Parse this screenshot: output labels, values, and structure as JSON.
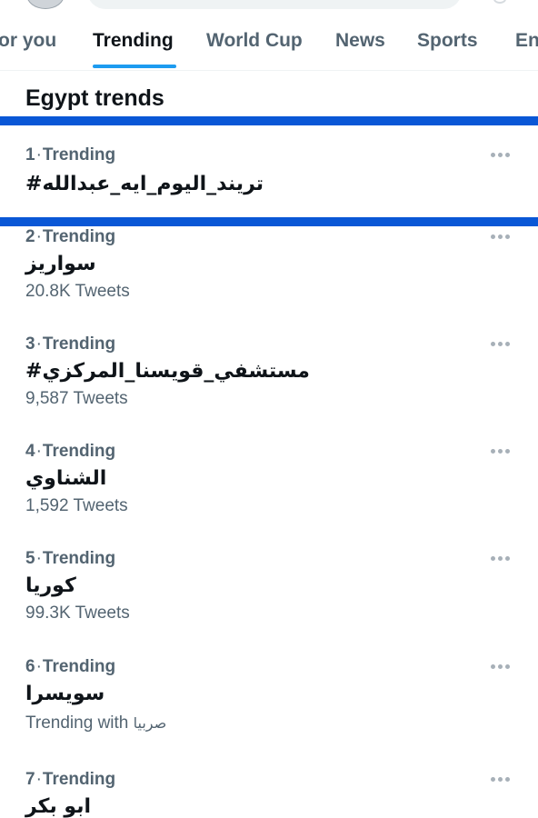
{
  "tabs": [
    {
      "label": "or you",
      "active": false
    },
    {
      "label": "Trending",
      "active": true
    },
    {
      "label": "World Cup",
      "active": false
    },
    {
      "label": "News",
      "active": false
    },
    {
      "label": "Sports",
      "active": false
    },
    {
      "label": "En",
      "active": false
    }
  ],
  "section": {
    "title": "Egypt trends"
  },
  "trend_label": "Trending",
  "colors": {
    "accent": "#1d9bf0",
    "highlight_border": "#0a57d6",
    "muted_text": "#536471"
  },
  "icons": {
    "more": "more-horizontal-icon"
  },
  "trends": [
    {
      "rank": "1",
      "context": "Trending",
      "name": "#تريند_اليوم_ايه_عبدالله",
      "count": ""
    },
    {
      "rank": "2",
      "context": "Trending",
      "name": "سواريز",
      "count": "20.8K Tweets"
    },
    {
      "rank": "3",
      "context": "Trending",
      "name": "#مستشفي_قويسنا_المركزي",
      "count": "9,587 Tweets"
    },
    {
      "rank": "4",
      "context": "Trending",
      "name": "الشناوي",
      "count": "1,592 Tweets"
    },
    {
      "rank": "5",
      "context": "Trending",
      "name": "كوريا",
      "count": "99.3K Tweets"
    },
    {
      "rank": "6",
      "context": "Trending",
      "name": "سويسرا",
      "count": "Trending with",
      "with": "صربيا"
    },
    {
      "rank": "7",
      "context": "Trending",
      "name": "ابو بكر",
      "count": ""
    }
  ]
}
